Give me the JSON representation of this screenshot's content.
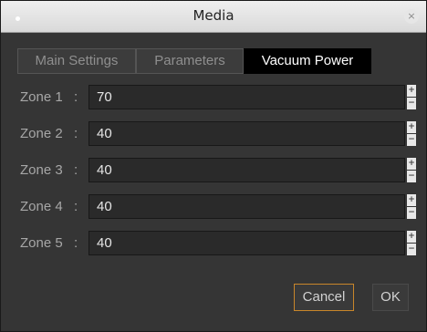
{
  "window": {
    "title": "Media",
    "close_glyph": "×"
  },
  "tabs": [
    {
      "label": "Main Settings",
      "active": false
    },
    {
      "label": "Parameters",
      "active": false
    },
    {
      "label": "Vacuum Power",
      "active": true
    }
  ],
  "zones": [
    {
      "label": "Zone 1",
      "separator": ":",
      "value": "70"
    },
    {
      "label": "Zone 2",
      "separator": ":",
      "value": "40"
    },
    {
      "label": "Zone 3",
      "separator": ":",
      "value": "40"
    },
    {
      "label": "Zone 4",
      "separator": ":",
      "value": "40"
    },
    {
      "label": "Zone 5",
      "separator": ":",
      "value": "40"
    }
  ],
  "spinner": {
    "up_glyph": "+",
    "down_glyph": "−"
  },
  "buttons": {
    "cancel_label": "Cancel",
    "ok_label": "OK"
  },
  "colors": {
    "accent_focus": "#c8862a",
    "active_tab": "#000000"
  }
}
